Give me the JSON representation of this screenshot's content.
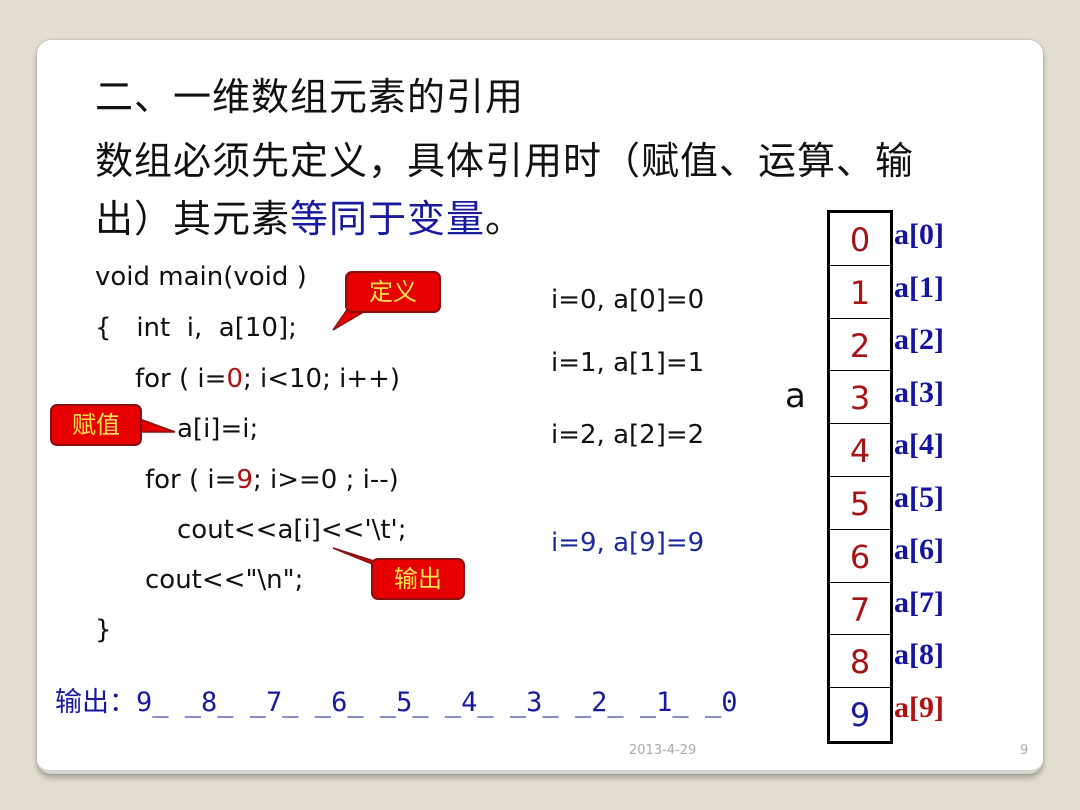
{
  "slide": {
    "title": "二、一维数组元素的引用",
    "body": {
      "line1": "数组必须先定义，具体引用时（赋值、运算、输",
      "line2_prefix": "出）其元素",
      "line2_highlight": "等同于变量",
      "line2_suffix": "。"
    },
    "code": {
      "line1": "void main(void )",
      "line2": "{   int  i,  a[10];",
      "line3_a": "for ( i=",
      "line3_red": "0",
      "line3_b": "; i<10; i++)",
      "line4": "a[i]=i;",
      "line5_a": "for ( i=",
      "line5_red": "9",
      "line5_b": "; i>=0 ; i--)",
      "line6": "cout<<a[i]<<'\\t';",
      "line7": "cout<<\"\\n\";",
      "line8": "}"
    },
    "callouts": {
      "define": "定义",
      "assign": "赋值",
      "output": "输出"
    },
    "trace": [
      "i=0, a[0]=0",
      "i=1, a[1]=1",
      "i=2, a[2]=2",
      "i=9, a[9]=9"
    ],
    "output": {
      "label": "输出：",
      "value": "9_ _8_ _7_ _6_ _5_ _4_ _3_ _2_ _1_ _0"
    },
    "array": {
      "name": "a",
      "values": [
        "0",
        "1",
        "2",
        "3",
        "4",
        "5",
        "6",
        "7",
        "8",
        "9"
      ],
      "indices": [
        "a[0]",
        "a[1]",
        "a[2]",
        "a[3]",
        "a[4]",
        "a[5]",
        "a[6]",
        "a[7]",
        "a[8]",
        "a[9]"
      ]
    },
    "footer": {
      "date": "2013-4-29",
      "page": "9"
    },
    "colors": {
      "highlight_blue": "#1a1aa0",
      "accent_red": "#b01010",
      "callout_fill": "#e60000",
      "callout_text": "#ffe34a"
    }
  }
}
